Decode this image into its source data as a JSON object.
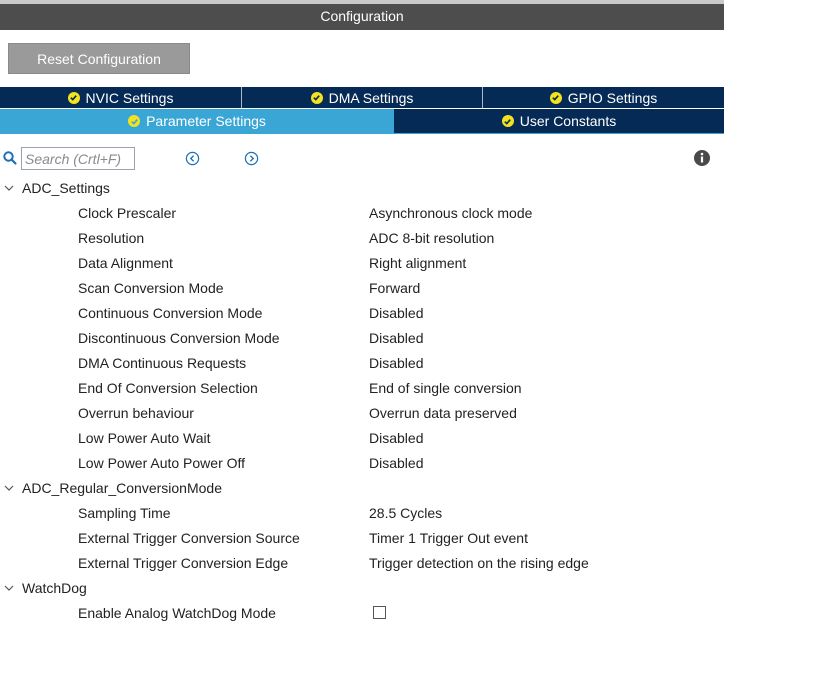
{
  "title": "Configuration",
  "reset_button": "Reset Configuration",
  "tabs_row1": [
    {
      "label": "NVIC Settings"
    },
    {
      "label": "DMA Settings"
    },
    {
      "label": "GPIO Settings"
    }
  ],
  "tabs_row2": [
    {
      "label": "Parameter Settings",
      "active": true
    },
    {
      "label": "User Constants",
      "active": false
    }
  ],
  "search": {
    "placeholder": "Search (Crtl+F)"
  },
  "colors": {
    "tab_dark": "#052a55",
    "tab_active": "#3aa6d6",
    "check_badge": "#f3e21f",
    "title_bar": "#4d4d4d"
  },
  "icons": {
    "search": "search-icon",
    "previous": "circle-chevron-left-icon",
    "next": "circle-chevron-right-icon",
    "info": "info-icon",
    "tab_check": "check-circle-icon",
    "expand": "chevron-down-icon"
  },
  "groups": [
    {
      "name": "ADC_Settings",
      "params": [
        {
          "name": "Clock Prescaler",
          "value": "Asynchronous clock mode"
        },
        {
          "name": "Resolution",
          "value": "ADC 8-bit resolution"
        },
        {
          "name": "Data Alignment",
          "value": "Right alignment"
        },
        {
          "name": "Scan Conversion Mode",
          "value": "Forward"
        },
        {
          "name": "Continuous Conversion Mode",
          "value": "Disabled"
        },
        {
          "name": "Discontinuous Conversion Mode",
          "value": "Disabled"
        },
        {
          "name": "DMA Continuous Requests",
          "value": "Disabled"
        },
        {
          "name": "End Of Conversion Selection",
          "value": "End of single conversion"
        },
        {
          "name": "Overrun behaviour",
          "value": "Overrun data preserved"
        },
        {
          "name": "Low Power Auto Wait",
          "value": "Disabled"
        },
        {
          "name": "Low Power Auto Power Off",
          "value": "Disabled"
        }
      ]
    },
    {
      "name": "ADC_Regular_ConversionMode",
      "params": [
        {
          "name": "Sampling Time",
          "value": "28.5 Cycles"
        },
        {
          "name": "External Trigger Conversion Source",
          "value": "Timer 1 Trigger Out event"
        },
        {
          "name": "External Trigger Conversion Edge",
          "value": "Trigger detection on the rising edge"
        }
      ]
    },
    {
      "name": "WatchDog",
      "params": [
        {
          "name": "Enable Analog WatchDog Mode",
          "checkbox": true,
          "checked": false
        }
      ]
    }
  ]
}
